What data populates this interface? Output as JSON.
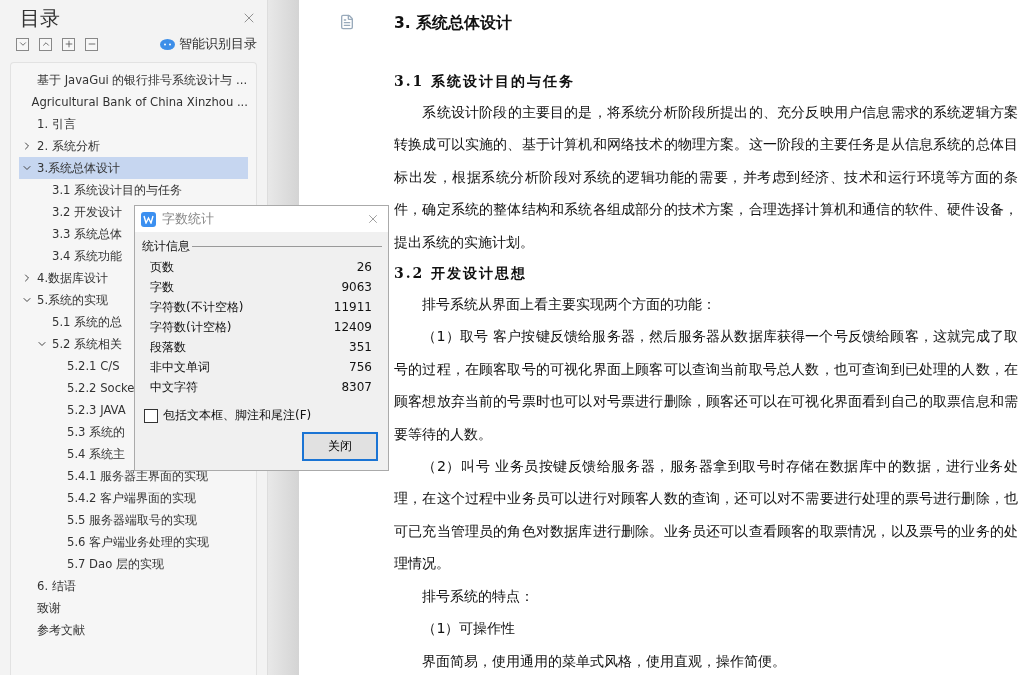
{
  "sidebar": {
    "title": "目录",
    "tools": [
      {
        "kind": "down"
      },
      {
        "kind": "up"
      },
      {
        "kind": "plus"
      },
      {
        "kind": "minus"
      }
    ],
    "smart_button": "智能识别目录",
    "tree": [
      {
        "label": "基于 JavaGui 的银行排号系统设计与 ...",
        "selected": false
      },
      {
        "label": "Agricultural Bank of China Xinzhou ...",
        "selected": false
      },
      {
        "label": "1.  引言",
        "selected": false
      },
      {
        "label": "2.  系统分析",
        "selected": false,
        "expanded": false
      },
      {
        "label": "3.系统总体设计",
        "selected": true,
        "expanded": true,
        "children": [
          {
            "label": "3.1  系统设计目的与任务",
            "selected": false
          },
          {
            "label": "3.2  开发设计",
            "selected": false
          },
          {
            "label": "3.3  系统总体",
            "selected": false
          },
          {
            "label": "3.4  系统功能",
            "selected": false
          }
        ]
      },
      {
        "label": "4.数据库设计",
        "selected": false,
        "expanded": false
      },
      {
        "label": "5.系统的实现",
        "selected": false,
        "expanded": true,
        "children": [
          {
            "label": "5.1  系统的总",
            "selected": false
          },
          {
            "label": "5.2  系统相关",
            "selected": false,
            "expanded": true,
            "children": [
              {
                "label": "5.2.1 C/S",
                "selected": false
              },
              {
                "label": "5.2.2 Socke",
                "selected": false
              },
              {
                "label": "5.2.3 JAVA",
                "selected": false
              },
              {
                "label": "5.3  系统的",
                "selected": false
              },
              {
                "label": "5.4  系统主",
                "selected": false
              },
              {
                "label": "5.4.1  服务器主界面的实现",
                "selected": false
              },
              {
                "label": "5.4.2  客户端界面的实现",
                "selected": false
              },
              {
                "label": "5.5  服务器端取号的实现",
                "selected": false
              },
              {
                "label": "5.6  客户端业务处理的实现",
                "selected": false
              },
              {
                "label": "5.7    Dao 层的实现",
                "selected": false
              }
            ]
          }
        ]
      },
      {
        "label": "6.  结语",
        "selected": false
      },
      {
        "label": "致谢",
        "selected": false
      },
      {
        "label": "参考文献",
        "selected": false
      }
    ]
  },
  "dialog": {
    "title": "字数统计",
    "group": "统计信息",
    "stats": [
      {
        "label": "页数",
        "value": "26"
      },
      {
        "label": "字数",
        "value": "9063"
      },
      {
        "label": "字符数(不计空格)",
        "value": "11911"
      },
      {
        "label": "字符数(计空格)",
        "value": "12409"
      },
      {
        "label": "段落数",
        "value": "351"
      },
      {
        "label": "非中文单词",
        "value": "756"
      },
      {
        "label": "中文字符",
        "value": "8307"
      }
    ],
    "option": {
      "label": "包括文本框、脚注和尾注(F)",
      "checked": false
    },
    "button": "关闭"
  },
  "document": [
    {
      "kind": "h1",
      "text": "3. 系统总体设计"
    },
    {
      "kind": "h2",
      "text": "3.1  系统设计目的与任务"
    },
    {
      "kind": "p",
      "text": "系统设计阶段的主要目的是，将系统分析阶段所提出的、充分反映用户信息需求的系统逻辑方案转换成可以实施的、基于计算机和网络技术的物理方案。这一阶段的主要任务是从信息系统的总体目标出发，根据系统分析阶段对系统的逻辑功能的需要，并考虑到经济、技术和运行环境等方面的条件，确定系统的整体结构和系统各组成部分的技术方案，合理选择计算机和通信的软件、硬件设备，提出系统的实施计划。"
    },
    {
      "kind": "h2",
      "text": "3.2  开发设计思想"
    },
    {
      "kind": "p",
      "text": "排号系统从界面上看主要实现两个方面的功能："
    },
    {
      "kind": "p",
      "text": "（1）取号  客户按键反馈给服务器，然后服务器从数据库获得一个号反馈给顾客，这就完成了取号的过程，在顾客取号的可视化界面上顾客可以查询当前取号总人数，也可查询到已处理的人数，在顾客想放弃当前的号票时也可以对号票进行删除，顾客还可以在可视化界面看到自己的取票信息和需要等待的人数。"
    },
    {
      "kind": "p",
      "text": "（2）叫号  业务员按键反馈给服务器，服务器拿到取号时存储在数据库中的数据，进行业务处理，在这个过程中业务员可以进行对顾客人数的查询，还可以对不需要进行处理的票号进行删除，也可已充当管理员的角色对数据库进行删除。业务员还可以查看顾客的取票情况，以及票号的业务的处理情况。"
    },
    {
      "kind": "p",
      "text": "排号系统的特点："
    },
    {
      "kind": "p",
      "text": "（1）可操作性"
    },
    {
      "kind": "p",
      "text": "界面简易，使用通用的菜单式风格，使用直观，操作简便。"
    }
  ]
}
